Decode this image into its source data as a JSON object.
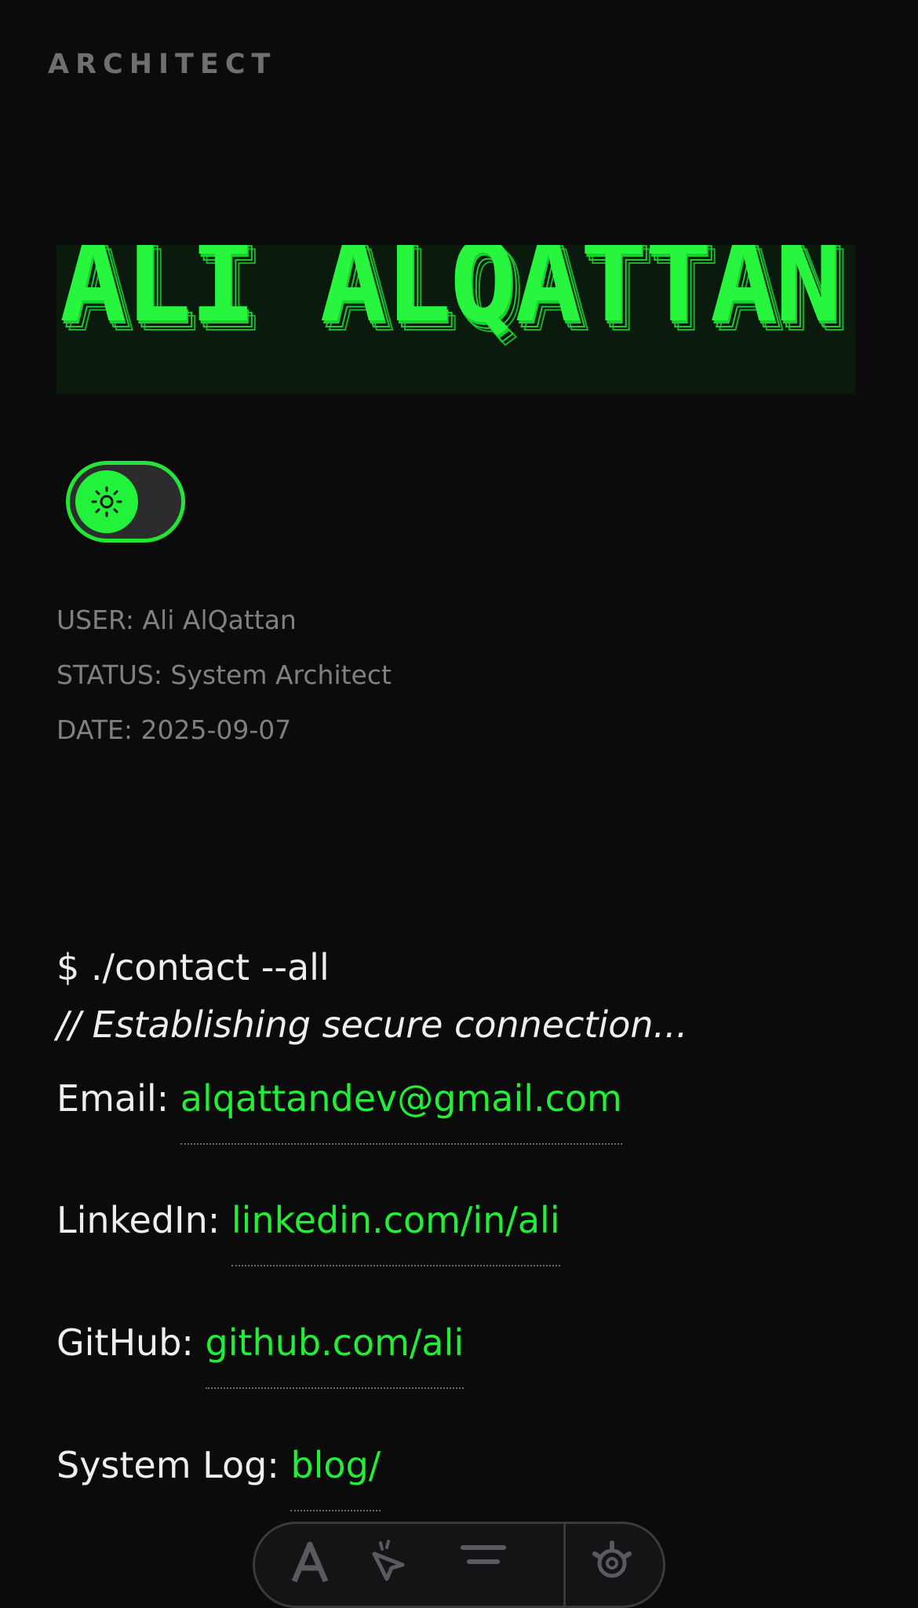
{
  "header": {
    "brand": "ARCHITECT"
  },
  "hero": {
    "name": "ALI ALQATTAN"
  },
  "theme_toggle": {
    "icon": "sun-icon"
  },
  "meta": {
    "user": "USER: Ali AlQattan",
    "status": "STATUS: System Architect",
    "date": "DATE: 2025-09-07"
  },
  "contact": {
    "command": "$ ./contact --all",
    "comment": "// Establishing secure connection...",
    "rows": [
      {
        "label": "Email:",
        "link": "alqattandev@gmail.com"
      },
      {
        "label": "LinkedIn:",
        "link": "linkedin.com/in/ali"
      },
      {
        "label": "GitHub:",
        "link": "github.com/ali"
      },
      {
        "label": "System Log:",
        "link": "blog/"
      }
    ]
  },
  "dock": {
    "items": [
      "font-icon",
      "pointer-icon",
      "align-icon",
      "settings-gear-icon"
    ]
  },
  "colors": {
    "background": "#0b0b0c",
    "accent": "#22ee38",
    "muted_text": "#808080",
    "hero_bg": "#0a1a0d"
  }
}
